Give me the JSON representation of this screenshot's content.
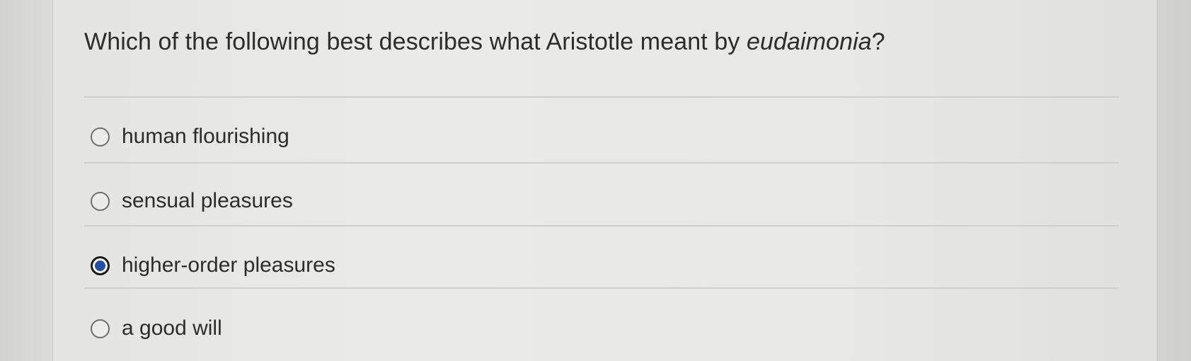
{
  "question": {
    "prefix": "Which of the following best describes what Aristotle meant by ",
    "emphasis": "eudaimonia",
    "suffix": "?"
  },
  "options": [
    {
      "label": "human flourishing",
      "selected": false
    },
    {
      "label": "sensual pleasures",
      "selected": false
    },
    {
      "label": "higher-order pleasures",
      "selected": true
    },
    {
      "label": "a good will",
      "selected": false
    }
  ],
  "colors": {
    "selected_radio": "#2450a6",
    "text": "#2c2c2c"
  }
}
